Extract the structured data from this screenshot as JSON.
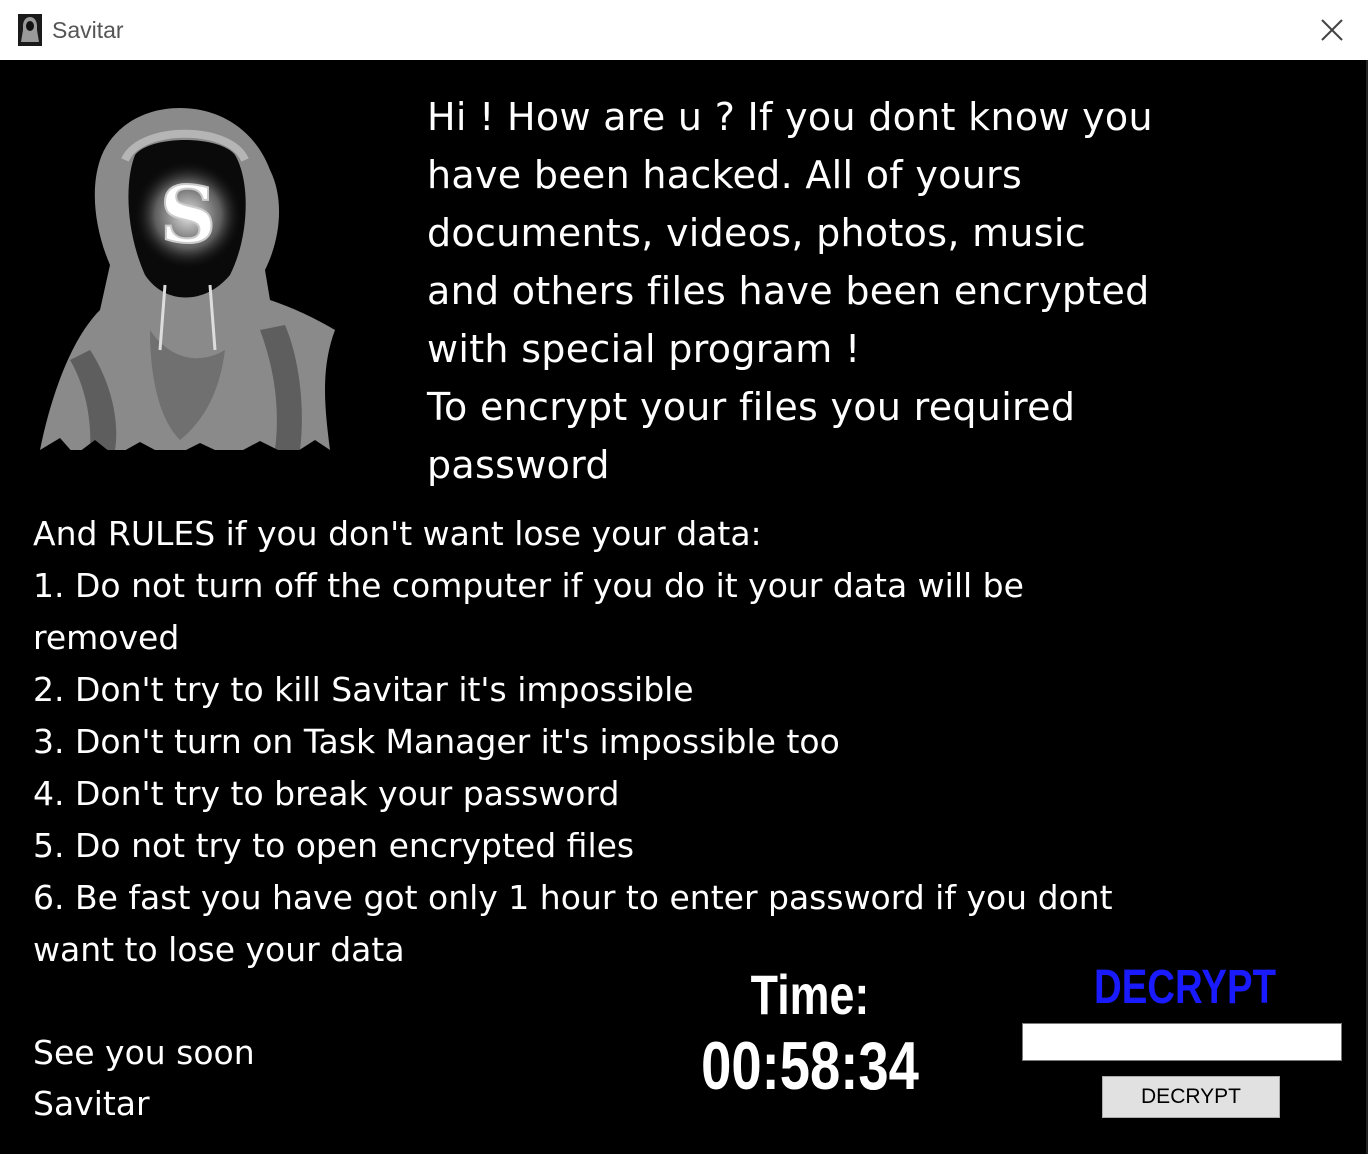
{
  "window": {
    "title": "Savitar",
    "app_icon": "hooded-figure-icon",
    "close_icon": "close-icon"
  },
  "intro": {
    "lines": [
      "Hi ! How are u ? If you dont know you",
      "have been hacked. All of yours",
      "documents, videos, photos, music",
      "and others files have been encrypted",
      "with special program !",
      "To encrypt your files you required",
      "password"
    ]
  },
  "rules": {
    "lines": [
      "And RULES if you don't want lose your data:",
      "1. Do not turn off the computer if you do it your data will be",
      "removed",
      "2. Don't try to kill Savitar it's impossible",
      "3. Don't turn on Task Manager it's impossible too",
      "4. Don't try to break your password",
      "5. Do not try to open encrypted files",
      "6. Be fast you have got only 1 hour to enter password if you dont",
      "want to lose your data"
    ]
  },
  "signoff": {
    "line1": "See you soon",
    "line2": "Savitar"
  },
  "image": {
    "logo_letter": "S"
  },
  "timer": {
    "label": "Time:",
    "value": "00:58:34"
  },
  "decrypt": {
    "heading": "DECRYPT",
    "input_value": "",
    "button_label": "DECRYPT"
  },
  "colors": {
    "background": "#000000",
    "text": "#ffffff",
    "decrypt_heading": "#1a1aff",
    "titlebar": "#ffffff"
  }
}
